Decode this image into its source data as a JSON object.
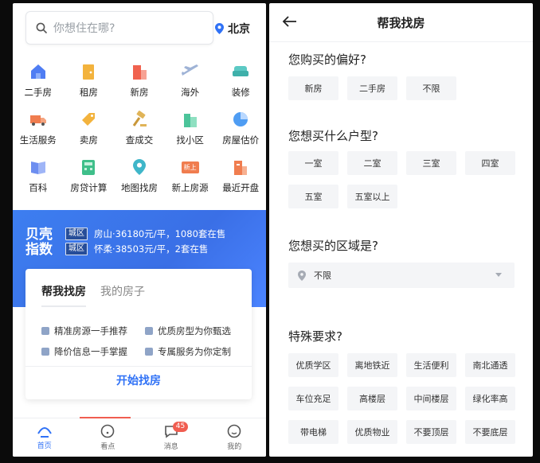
{
  "left": {
    "search": {
      "placeholder": "你想住在哪?"
    },
    "city": "北京",
    "categories": [
      {
        "label": "二手房",
        "icon": "house-icon",
        "color": "#4f7df3"
      },
      {
        "label": "租房",
        "icon": "door-icon",
        "color": "#f3b33d"
      },
      {
        "label": "新房",
        "icon": "building-icon",
        "color": "#f0624f"
      },
      {
        "label": "海外",
        "icon": "airplane-icon",
        "color": "#9fb3d6"
      },
      {
        "label": "装修",
        "icon": "sofa-icon",
        "color": "#5cc9c4"
      },
      {
        "label": "生活服务",
        "icon": "truck-icon",
        "color": "#f07d4f"
      },
      {
        "label": "卖房",
        "icon": "price-tag-icon",
        "color": "#f3b33d"
      },
      {
        "label": "查成交",
        "icon": "gavel-icon",
        "color": "#e0b458"
      },
      {
        "label": "找小区",
        "icon": "apartment-icon",
        "color": "#4cc49a"
      },
      {
        "label": "房屋估价",
        "icon": "pie-chart-icon",
        "color": "#4f9df3"
      },
      {
        "label": "百科",
        "icon": "book-icon",
        "color": "#6d8ef0"
      },
      {
        "label": "房贷计算",
        "icon": "calculator-icon",
        "color": "#3fbf8a"
      },
      {
        "label": "地图找房",
        "icon": "map-pin-icon",
        "color": "#3fb6c9"
      },
      {
        "label": "新上房源",
        "icon": "new-badge-icon",
        "color": "#f07d4f",
        "badge_text": "新上"
      },
      {
        "label": "最近开盘",
        "icon": "open-building-icon",
        "color": "#f07d4f"
      }
    ],
    "banner": {
      "brand_line1": "贝壳",
      "brand_line2": "指数",
      "rows": [
        {
          "tag": "城区",
          "text": "房山·36180元/平，1080套在售"
        },
        {
          "tag": "城区",
          "text": "怀柔·38503元/平，2套在售"
        }
      ]
    },
    "card": {
      "tabs": [
        "帮我找房",
        "我的房子"
      ],
      "features": [
        "精准房源一手推荐",
        "优质房型为你甄选",
        "降价信息一手掌握",
        "专属服务为你定制"
      ],
      "button": "开始找房"
    },
    "tabbar": {
      "items": [
        {
          "label": "首页",
          "icon": "home-icon"
        },
        {
          "label": "看点",
          "icon": "compass-icon"
        },
        {
          "label": "消息",
          "icon": "message-icon",
          "badge": "45"
        },
        {
          "label": "我的",
          "icon": "profile-icon"
        }
      ],
      "active_color": "#3072f6"
    }
  },
  "right": {
    "title": "帮我找房",
    "q1": {
      "label": "您购买的偏好?",
      "options": [
        "新房",
        "二手房",
        "不限"
      ]
    },
    "q2": {
      "label": "您想买什么户型?",
      "options": [
        "一室",
        "二室",
        "三室",
        "四室",
        "五室",
        "五室以上"
      ]
    },
    "q3": {
      "label": "您想买的区域是?",
      "value": "不限"
    },
    "q4": {
      "label": "特殊要求?",
      "options": [
        "优质学区",
        "离地铁近",
        "生活便利",
        "南北通透",
        "车位充足",
        "高楼层",
        "中间楼层",
        "绿化率高",
        "带电梯",
        "优质物业",
        "不要顶层",
        "不要底层"
      ]
    }
  }
}
